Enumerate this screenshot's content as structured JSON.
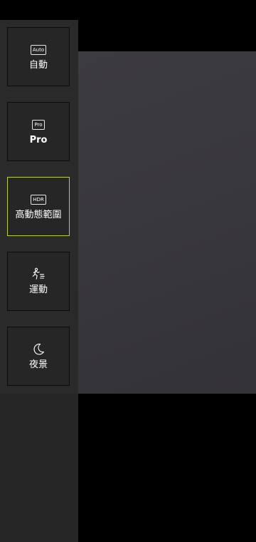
{
  "mode_panel": {
    "modes": [
      {
        "label": "自動",
        "badge": "Auto",
        "icon": "auto-badge-icon",
        "selected": false
      },
      {
        "label": "Pro",
        "badge": "Pro",
        "icon": "pro-badge-icon",
        "selected": false
      },
      {
        "label": "高動態範圍",
        "badge": "HDR",
        "icon": "hdr-badge-icon",
        "selected": true
      },
      {
        "label": "運動",
        "icon": "running-person-icon",
        "selected": false
      },
      {
        "label": "夜景",
        "icon": "crescent-moon-icon",
        "selected": false
      }
    ]
  },
  "colors": {
    "selected_border": "#b7cf3a",
    "panel_background": "#2a2a2a",
    "viewfinder": "#3a393d"
  }
}
